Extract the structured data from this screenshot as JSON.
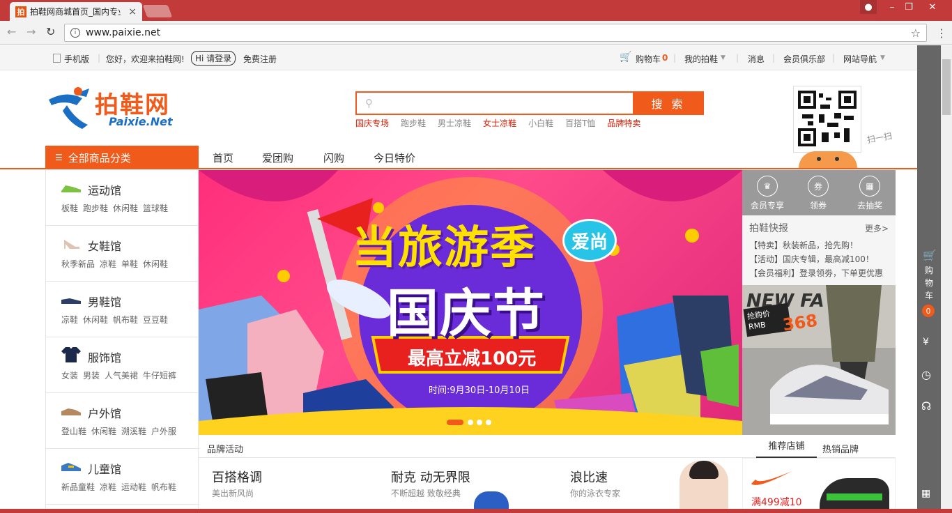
{
  "browser": {
    "tab_title": "拍鞋网商城首页_国内专业",
    "tab_favicon": "拍",
    "url": "www.paixie.net",
    "accent": "#c23b3a"
  },
  "topbar": {
    "mobile": "手机版",
    "welcome": "您好，欢迎来拍鞋网!",
    "login": "Hi 请登录",
    "register": "免费注册",
    "cart": "购物车",
    "cart_count": "0",
    "my_account": "我的拍鞋",
    "messages": "消息",
    "club": "会员俱乐部",
    "site_nav": "网站导航"
  },
  "header": {
    "logo_text": "拍鞋网",
    "logo_sub": "Paixie.Net",
    "search_button": "搜 索",
    "search_placeholder": "",
    "hotwords": [
      {
        "text": "国庆专场",
        "red": true
      },
      {
        "text": "跑步鞋",
        "red": false
      },
      {
        "text": "男士凉鞋",
        "red": false
      },
      {
        "text": "女士凉鞋",
        "red": true
      },
      {
        "text": "小白鞋",
        "red": false
      },
      {
        "text": "百搭T恤",
        "red": false
      },
      {
        "text": "品牌特卖",
        "red": true
      }
    ],
    "qr_caption": "扫一扫"
  },
  "nav": {
    "all_categories": "全部商品分类",
    "items": [
      "首页",
      "爱团购",
      "闪购",
      "今日特价"
    ]
  },
  "categories": [
    {
      "title": "运动馆",
      "subs": [
        "板鞋",
        "跑步鞋",
        "休闲鞋",
        "篮球鞋"
      ],
      "icon": "sneaker-icon"
    },
    {
      "title": "女鞋馆",
      "subs": [
        "秋季新品",
        "凉鞋",
        "单鞋",
        "休闲鞋"
      ],
      "icon": "heel-icon"
    },
    {
      "title": "男鞋馆",
      "subs": [
        "凉鞋",
        "休闲鞋",
        "帆布鞋",
        "豆豆鞋"
      ],
      "icon": "mens-shoe-icon"
    },
    {
      "title": "服饰馆",
      "subs": [
        "女装",
        "男装",
        "人气美裙",
        "牛仔短裤"
      ],
      "icon": "tshirt-icon"
    },
    {
      "title": "户外馆",
      "subs": [
        "登山鞋",
        "休闲鞋",
        "溯溪鞋",
        "户外服"
      ],
      "icon": "boot-icon"
    },
    {
      "title": "儿童馆",
      "subs": [
        "新品童鞋",
        "凉鞋",
        "运动鞋",
        "帆布鞋"
      ],
      "icon": "kids-shoe-icon"
    }
  ],
  "banner": {
    "line1": "当旅游季",
    "bubble": "爱尚",
    "line2": "国庆节",
    "ribbon": "最高立减100元",
    "date": "时间:9月30日-10月10日"
  },
  "member": {
    "items": [
      {
        "label": "会员专享",
        "icon": "crown-icon",
        "glyph": "♛"
      },
      {
        "label": "领券",
        "icon": "coupon-icon",
        "glyph": "券"
      },
      {
        "label": "去抽奖",
        "icon": "gift-icon",
        "glyph": "▦"
      }
    ]
  },
  "news": {
    "title": "拍鞋快报",
    "more": "更多>",
    "items": [
      "【特卖】秋装新品，抢先购！",
      "【活动】国庆专辑，最高减100！",
      "【会员福利】登录领劵，下单更优惠"
    ]
  },
  "shoe_ad": {
    "brand_text": "NEW FA",
    "price_label": "抢购价",
    "currency": "RMB",
    "price": "368"
  },
  "brand_row": {
    "title": "品牌活动",
    "tab_recommended": "推荐店铺",
    "tab_hot": "热销品牌",
    "brands": [
      {
        "name": "百搭格调",
        "slogan": "美出新风尚"
      },
      {
        "name": "耐克 动无界限",
        "slogan": "不断超越 致敬经典"
      },
      {
        "name": "浪比速",
        "slogan": "你的泳衣专家"
      }
    ],
    "nike_promo": "满499减10"
  },
  "rightbar": {
    "cart_label": "购物车",
    "cart_count": "0"
  }
}
